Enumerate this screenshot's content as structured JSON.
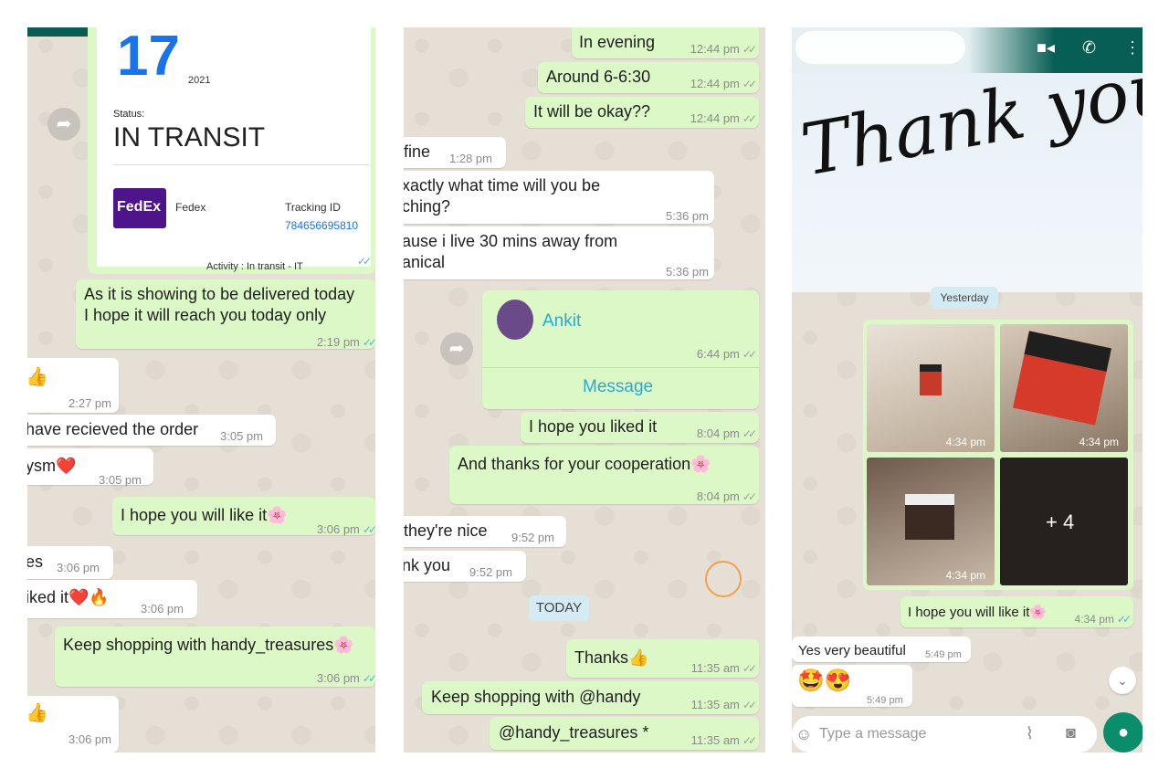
{
  "panel1": {
    "card": {
      "date_day": "17",
      "date_year": "2021",
      "status_label": "Status:",
      "status_value": "IN TRANSIT",
      "carrier_logo": "FedEx",
      "carrier_name": "Fedex",
      "tracking_label": "Tracking ID",
      "tracking_id": "784656695810",
      "activity": "Activity : In transit - IT",
      "time": "2:19 pm"
    },
    "messages": [
      {
        "dir": "out",
        "lines": [
          "As it is showing to be delivered today",
          "I hope it will reach you today only"
        ],
        "time": "2:19 pm"
      },
      {
        "dir": "in",
        "lines": [
          "👍"
        ],
        "time": "2:27 pm"
      },
      {
        "dir": "in",
        "lines": [
          "have recieved the order"
        ],
        "time": "3:05 pm"
      },
      {
        "dir": "in",
        "lines": [
          "ysm❤️"
        ],
        "time": "3:05 pm"
      },
      {
        "dir": "out",
        "lines": [
          "I hope you will like it🌸"
        ],
        "time": "3:06 pm"
      },
      {
        "dir": "in",
        "lines": [
          "es"
        ],
        "time": "3:06 pm"
      },
      {
        "dir": "in",
        "lines": [
          "iked it❤️🔥"
        ],
        "time": "3:06 pm"
      },
      {
        "dir": "out",
        "lines": [
          "Keep shopping with handy_treasures🌸"
        ],
        "time": "3:06 pm"
      },
      {
        "dir": "in",
        "lines": [
          "👍"
        ],
        "time": "3:06 pm"
      }
    ]
  },
  "panel2": {
    "messages": [
      {
        "dir": "out",
        "lines": [
          "In evening"
        ],
        "time": "12:44 pm"
      },
      {
        "dir": "out",
        "lines": [
          "Around 6-6:30"
        ],
        "time": "12:44 pm"
      },
      {
        "dir": "out",
        "lines": [
          "It will be okay??"
        ],
        "time": "12:44 pm"
      },
      {
        "dir": "in",
        "lines": [
          "fine"
        ],
        "time": "1:28 pm"
      },
      {
        "dir": "in",
        "lines": [
          "xactly what time will you be",
          "ching?"
        ],
        "time": "5:36 pm"
      },
      {
        "dir": "in",
        "lines": [
          "ause i live 30 mins away from",
          "anical"
        ],
        "time": "5:36 pm"
      }
    ],
    "contact_card": {
      "name": "Ankit",
      "time": "6:44 pm",
      "action": "Message"
    },
    "messages2": [
      {
        "dir": "out",
        "lines": [
          "I hope you liked it"
        ],
        "time": "8:04 pm"
      },
      {
        "dir": "out",
        "lines": [
          "And thanks for your cooperation🌸"
        ],
        "time": "8:04 pm"
      },
      {
        "dir": "in",
        "lines": [
          "they're nice"
        ],
        "time": "9:52 pm"
      },
      {
        "dir": "in",
        "lines": [
          "nk you"
        ],
        "time": "9:52 pm"
      }
    ],
    "date_chip": "TODAY",
    "messages3": [
      {
        "dir": "out",
        "lines": [
          "Thanks👍"
        ],
        "time": "11:35 am"
      },
      {
        "dir": "out",
        "lines": [
          "Keep shopping with @handy"
        ],
        "time": "11:35 am"
      },
      {
        "dir": "out",
        "lines": [
          "@handy_treasures *"
        ],
        "time": "11:35 am"
      }
    ]
  },
  "panel3": {
    "overlay_text": "Thank you!",
    "date_chip": "Yesterday",
    "photo_times": [
      "4:34 pm",
      "4:34 pm",
      "4:34 pm"
    ],
    "more_count": "+ 4",
    "messages": [
      {
        "dir": "out",
        "lines": [
          "I hope you will like it🌸"
        ],
        "time": "4:34 pm"
      },
      {
        "dir": "in",
        "lines": [
          "Yes very beautiful"
        ],
        "time": "5:49 pm"
      },
      {
        "dir": "in",
        "lines": [
          "🤩😍"
        ],
        "time": "5:49 pm"
      }
    ],
    "input_placeholder": "Type a message",
    "icons": [
      "video-call-icon",
      "voice-call-icon",
      "more-options-icon",
      "emoji-icon",
      "attach-icon",
      "camera-icon",
      "mic-icon",
      "scroll-down-icon"
    ]
  },
  "colors": {
    "outgoing": "#dcf8c6",
    "incoming": "#ffffff",
    "header": "#075e54",
    "read_tick": "#4fb3e8",
    "mic": "#0a8d6b"
  }
}
